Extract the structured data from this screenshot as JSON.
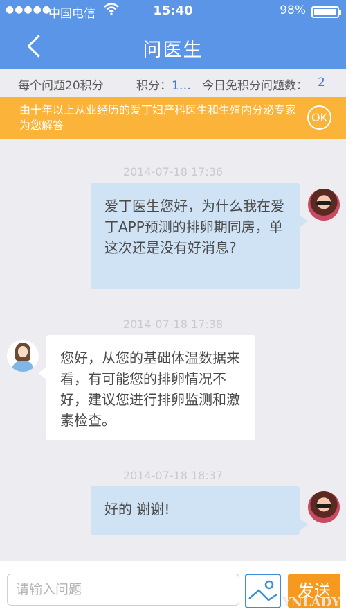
{
  "status_bar": {
    "signal": "●●●●●",
    "carrier": "中国电信",
    "time": "15:40",
    "battery": "98%"
  },
  "nav": {
    "title": "问医生"
  },
  "info_bar": {
    "cost": "每个问题20积分",
    "points_label": "积分：",
    "points_value": "1…",
    "free_label": "今日免积分问题数：",
    "free_value": "2"
  },
  "banner": {
    "text": "由十年以上从业经历的爱丁妇产科医生和生殖内分泌专家为您解答",
    "ok_label": "OK"
  },
  "messages": [
    {
      "timestamp": "2014-07-18 17:36",
      "sender": "user",
      "text": "爱丁医生您好，为什么我在爱丁APP预测的排卵期同房，单这次还是没有好消息?"
    },
    {
      "timestamp": "2014-07-18 17:38",
      "sender": "doctor",
      "text": "您好，从您的基础体温数据来看，有可能您的排卵情况不好，建议您进行排卵监测和激素检查。"
    },
    {
      "timestamp": "2014-07-18 18:37",
      "sender": "user",
      "text": "好的 谢谢!"
    }
  ],
  "input": {
    "placeholder": "请输入问题",
    "send_label": "发送"
  },
  "watermark": "YNLADY",
  "colors": {
    "nav_bg": "#5b95e8",
    "banner_bg": "#fbb33a",
    "user_bubble": "#cfe3f5",
    "doctor_bubble": "#ffffff",
    "send_button": "#f59a1e",
    "accent_value": "#3a7bd5"
  }
}
